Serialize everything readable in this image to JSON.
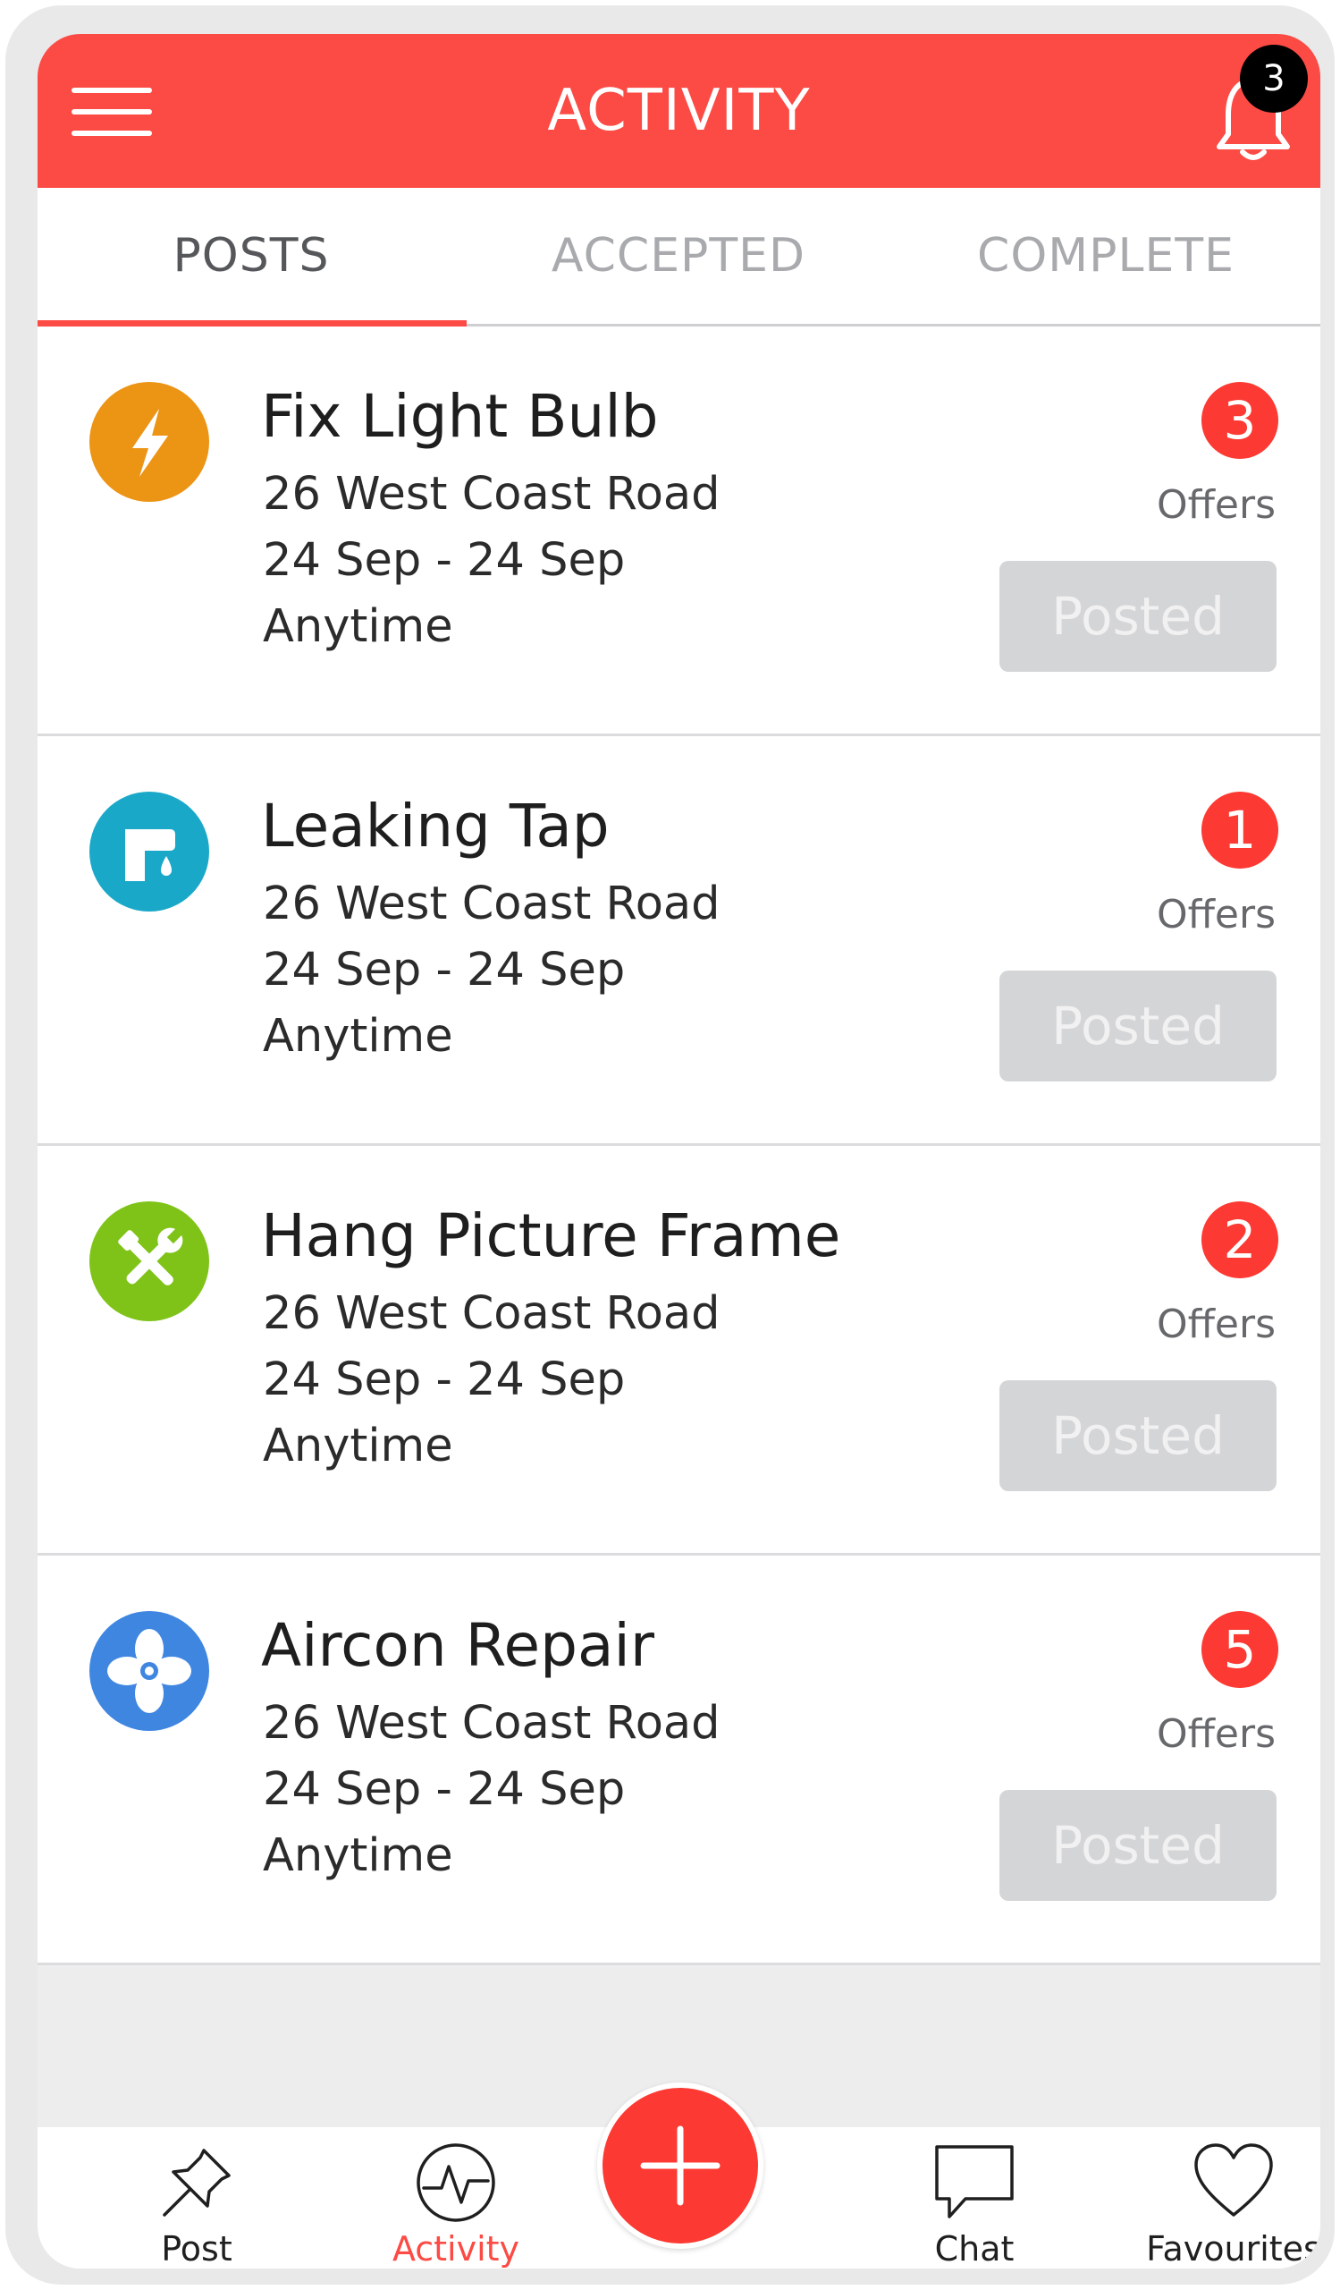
{
  "header": {
    "title": "ACTIVITY",
    "notification_count": "3",
    "accent": "#fc4a44"
  },
  "tabs": [
    {
      "label": "POSTS",
      "active": true
    },
    {
      "label": "ACCEPTED",
      "active": false
    },
    {
      "label": "COMPLETE",
      "active": false
    }
  ],
  "posts": [
    {
      "title": "Fix Light Bulb",
      "address": "26 West Coast Road",
      "dates": "24 Sep - 24 Sep",
      "time": "Anytime",
      "offers": "3",
      "offers_label": "Offers",
      "status": "Posted",
      "icon": "lightning-icon",
      "icon_color": "#ec9414"
    },
    {
      "title": "Leaking Tap",
      "address": "26 West Coast Road",
      "dates": "24 Sep - 24 Sep",
      "time": "Anytime",
      "offers": "1",
      "offers_label": "Offers",
      "status": "Posted",
      "icon": "tap-icon",
      "icon_color": "#1aa8c9"
    },
    {
      "title": "Hang Picture Frame",
      "address": "26 West Coast Road",
      "dates": "24 Sep - 24 Sep",
      "time": "Anytime",
      "offers": "2",
      "offers_label": "Offers",
      "status": "Posted",
      "icon": "tools-icon",
      "icon_color": "#7fc318"
    },
    {
      "title": "Aircon Repair",
      "address": "26 West Coast Road",
      "dates": "24 Sep - 24 Sep",
      "time": "Anytime",
      "offers": "5",
      "offers_label": "Offers",
      "status": "Posted",
      "icon": "fan-icon",
      "icon_color": "#3f86e1"
    }
  ],
  "bottom_nav": [
    {
      "label": "Post",
      "icon": "pin-icon",
      "active": false
    },
    {
      "label": "Activity",
      "icon": "activity-icon",
      "active": true
    },
    {
      "label": "Chat",
      "icon": "chat-icon",
      "active": false
    },
    {
      "label": "Favourites",
      "icon": "heart-icon",
      "active": false
    }
  ],
  "fab_icon": "plus-icon"
}
